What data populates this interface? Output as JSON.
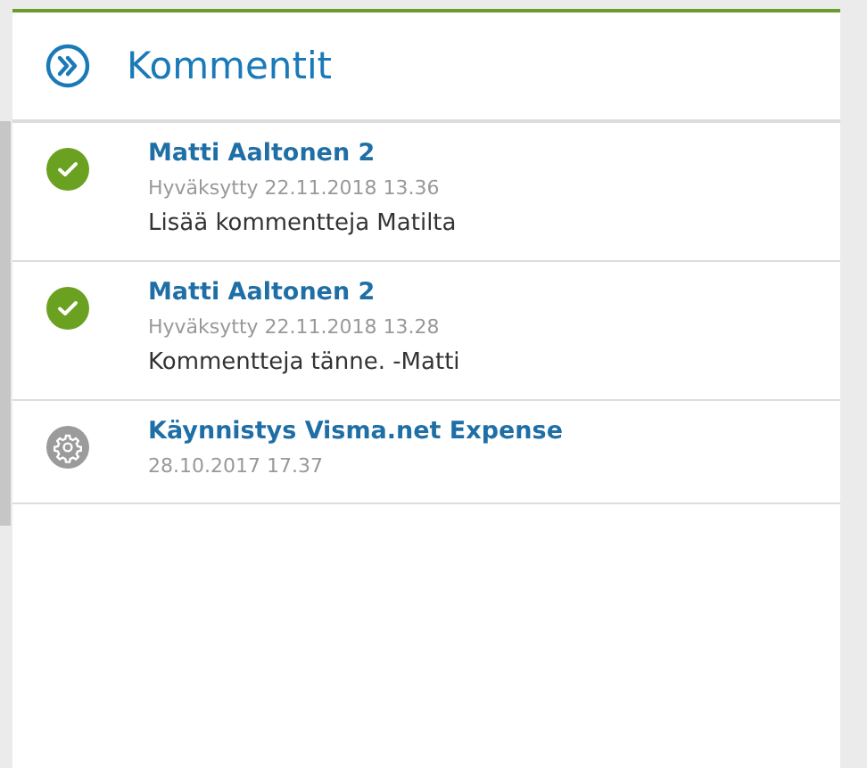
{
  "panel": {
    "title": "Kommentit"
  },
  "comments": [
    {
      "kind": "approved",
      "author": "Matti Aaltonen 2",
      "meta": "Hyväksytty 22.11.2018 13.36",
      "text": "Lisää kommentteja Matilta"
    },
    {
      "kind": "approved",
      "author": "Matti Aaltonen 2",
      "meta": "Hyväksytty 22.11.2018 13.28",
      "text": "Kommentteja tänne. -Matti"
    },
    {
      "kind": "system",
      "author": "Käynnistys Visma.net Expense",
      "meta": "28.10.2017 17.37"
    }
  ]
}
